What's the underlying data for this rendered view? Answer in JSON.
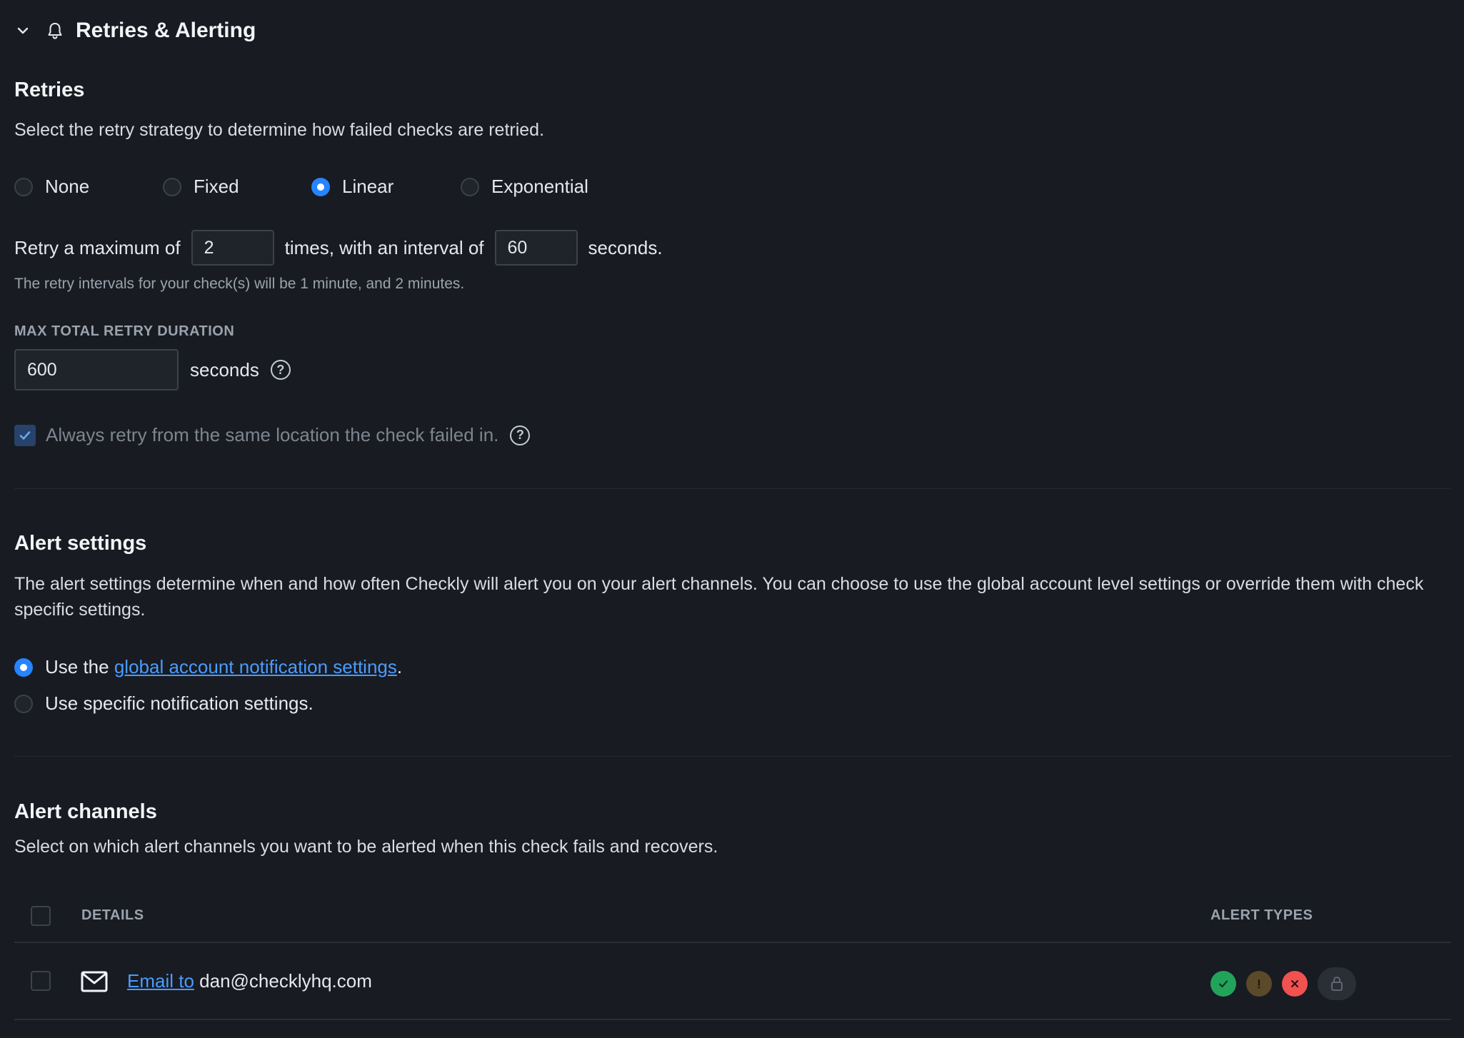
{
  "section": {
    "title": "Retries & Alerting"
  },
  "retries": {
    "heading": "Retries",
    "description": "Select the retry strategy to determine how failed checks are retried.",
    "strategies": [
      {
        "label": "None",
        "selected": false
      },
      {
        "label": "Fixed",
        "selected": false
      },
      {
        "label": "Linear",
        "selected": true
      },
      {
        "label": "Exponential",
        "selected": false
      }
    ],
    "sentence_prefix": "Retry a maximum of",
    "max_retries": "2",
    "sentence_middle": "times, with an interval of",
    "interval": "60",
    "sentence_suffix": "seconds.",
    "hint": "The retry intervals for your check(s) will be 1 minute, and 2 minutes.",
    "max_duration_label": "MAX TOTAL RETRY DURATION",
    "max_duration": "600",
    "max_duration_unit": "seconds",
    "same_location_label": "Always retry from the same location the check failed in.",
    "same_location_checked": true
  },
  "alert_settings": {
    "heading": "Alert settings",
    "description": "The alert settings determine when and how often Checkly will alert you on your alert channels. You can choose to use the global account level settings or override them with check specific settings.",
    "option_global_prefix": "Use the",
    "option_global_link": "global account notification settings",
    "option_global_suffix": ".",
    "option_specific": "Use specific notification settings.",
    "selected": "global"
  },
  "alert_channels": {
    "heading": "Alert channels",
    "description": "Select on which alert channels you want to be alerted when this check fails and recovers.",
    "col_details": "DETAILS",
    "col_alert_types": "ALERT TYPES",
    "rows": [
      {
        "icon": "mail-icon",
        "link": "Email to",
        "target": "dan@checklyhq.com",
        "alert_types": [
          "recovery",
          "degraded",
          "failure",
          "ssl-locked"
        ]
      }
    ]
  },
  "colors": {
    "background": "#181b21",
    "accent": "#2684ff",
    "link": "#4a9cff",
    "success": "#22a35a",
    "degraded": "#5a4a2a",
    "failure": "#f0524f",
    "lock": "#2a2f37"
  }
}
